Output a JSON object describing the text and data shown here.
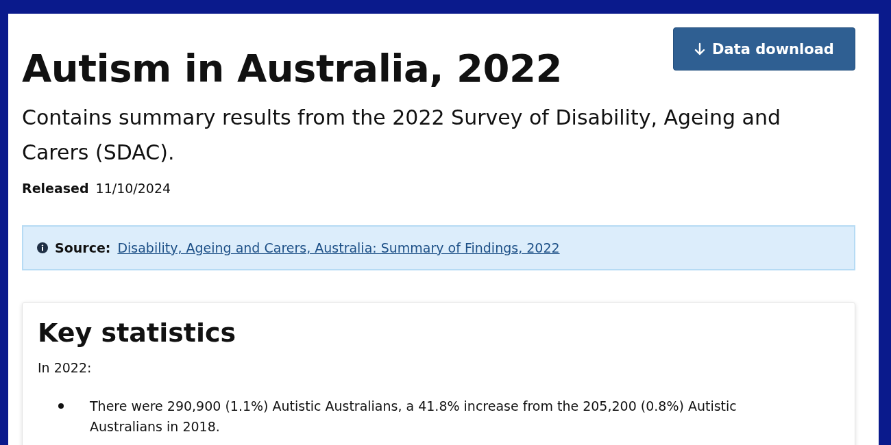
{
  "header": {
    "title": "Autism in Australia, 2022",
    "subtitle": "Contains summary results from the 2022 Survey of Disability, Ageing and Carers (SDAC).",
    "download_button": "Data download"
  },
  "released": {
    "label": "Released",
    "date": "11/10/2024"
  },
  "source": {
    "label": "Source:",
    "link": "Disability, Ageing and Carers, Australia: Summary of Findings, 2022"
  },
  "key_statistics": {
    "heading": "Key statistics",
    "intro": "In 2022:",
    "bullets": [
      "There were 290,900 (1.1%) Autistic Australians, a 41.8% increase from the 205,200 (0.8%) Autistic Australians in 2018."
    ]
  }
}
